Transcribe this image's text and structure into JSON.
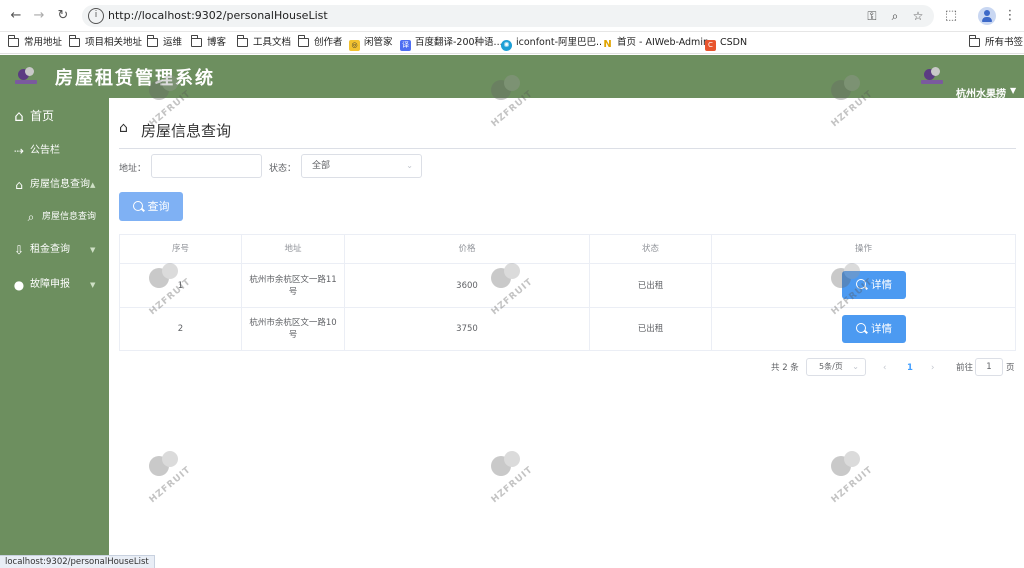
{
  "browser": {
    "url": "http://localhost:9302/personalHouseList",
    "status_url": "localhost:9302/personalHouseList"
  },
  "bookmarks": {
    "items": [
      "常用地址",
      "项目相关地址",
      "运维",
      "博客",
      "工具文档",
      "创作者",
      "闲管家",
      "百度翻译-200种语...",
      "iconfont-阿里巴巴...",
      "首页 - AIWeb-Admin",
      "CSDN"
    ],
    "all_bookmarks": "所有书签"
  },
  "header": {
    "title": "房屋租赁管理系统",
    "user": "杭州水果捞"
  },
  "sidebar": {
    "items": [
      {
        "label": "首页"
      },
      {
        "label": "公告栏"
      },
      {
        "label": "房屋信息查询"
      },
      {
        "label": "房屋信息查询"
      },
      {
        "label": "租金查询"
      },
      {
        "label": "故障申报"
      }
    ]
  },
  "main": {
    "heading": "房屋信息查询",
    "form": {
      "address_label": "地址：",
      "address_value": "",
      "status_label": "状态：",
      "status_value": "全部",
      "query_button": "查询"
    },
    "table": {
      "columns": [
        "序号",
        "地址",
        "价格",
        "状态",
        "操作"
      ],
      "rows": [
        {
          "index": "1",
          "address": "杭州市余杭区文一路11号",
          "price": "3600",
          "status": "已出租",
          "action": "详情"
        },
        {
          "index": "2",
          "address": "杭州市余杭区文一路10号",
          "price": "3750",
          "status": "已出租",
          "action": "详情"
        }
      ]
    },
    "pagination": {
      "total": "共 2 条",
      "page_size": "5条/页",
      "current_page": "1",
      "goto_label": "前往",
      "goto_value": "1",
      "page_suffix": "页"
    }
  },
  "watermark": {
    "text": "杭州水果捞 HZFRUIT"
  },
  "colors": {
    "sidebar": "#6d8f5f",
    "button": "#4c9af1",
    "query_button": "#7fb1f4",
    "link": "#409eff"
  }
}
